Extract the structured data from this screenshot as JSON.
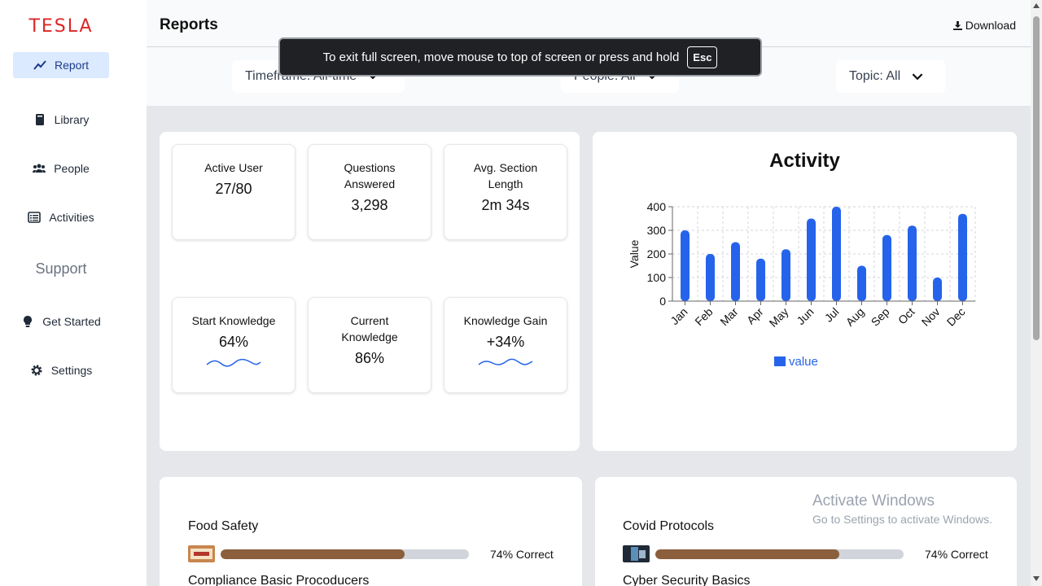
{
  "brand": "TESLA",
  "sidebar": {
    "items": [
      {
        "label": "Report",
        "icon": "trend-line-icon",
        "active": true
      },
      {
        "label": "Library",
        "icon": "book-icon"
      },
      {
        "label": "People",
        "icon": "users-icon"
      },
      {
        "label": "Activities",
        "icon": "list-icon"
      }
    ],
    "section_label": "Support",
    "support_items": [
      {
        "label": "Get Started",
        "icon": "lightbulb-icon"
      },
      {
        "label": "Settings",
        "icon": "gear-icon"
      }
    ]
  },
  "header": {
    "title": "Reports",
    "download_label": "Download"
  },
  "filters": {
    "timeframe": "Timeframe: All-time",
    "people": "People: All",
    "topic": "Topic: All"
  },
  "fullscreen_notice": {
    "text": "To exit full screen, move mouse to top of screen or press and hold",
    "key": "Esc"
  },
  "stats": [
    {
      "label": "Active User",
      "value": "27/80"
    },
    {
      "label": "Questions Answered",
      "value": "3,298"
    },
    {
      "label": "Avg. Section Length",
      "value": "2m 34s"
    },
    {
      "label": "Start Knowledge",
      "value": "64%",
      "sparkline": true
    },
    {
      "label": "Current Knowledge",
      "value": "86%"
    },
    {
      "label": "Knowledge Gain",
      "value": "+34%",
      "sparkline": true
    }
  ],
  "activity": {
    "title": "Activity",
    "legend": "value"
  },
  "chart_data": {
    "type": "bar",
    "title": "Activity",
    "categories": [
      "Jan",
      "Feb",
      "Mar",
      "Apr",
      "May",
      "Jun",
      "Jul",
      "Aug",
      "Sep",
      "Oct",
      "Nov",
      "Dec"
    ],
    "series": [
      {
        "name": "value",
        "values": [
          300,
          200,
          250,
          180,
          220,
          350,
          400,
          150,
          280,
          320,
          100,
          370
        ]
      }
    ],
    "xlabel": "",
    "ylabel": "Value",
    "ylim": [
      0,
      400
    ],
    "yticks": [
      0,
      100,
      200,
      300,
      400
    ],
    "grid": true,
    "legend_position": "bottom",
    "color": "#2563eb"
  },
  "courses": [
    {
      "title": "Food Safety",
      "percent": 74,
      "percent_label": "74% Correct",
      "subtitle": "Compliance Basic Procoducers"
    },
    {
      "title": "Covid Protocols",
      "percent": 74,
      "percent_label": "74% Correct",
      "subtitle": "Cyber Security Basics"
    }
  ],
  "watermark": {
    "title": "Activate Windows",
    "subtitle": "Go to Settings to activate Windows."
  },
  "colors": {
    "brand": "#dc2626",
    "accent": "#2563eb",
    "progress": "#8b5e3c",
    "active_nav_bg": "#dbeafe"
  }
}
